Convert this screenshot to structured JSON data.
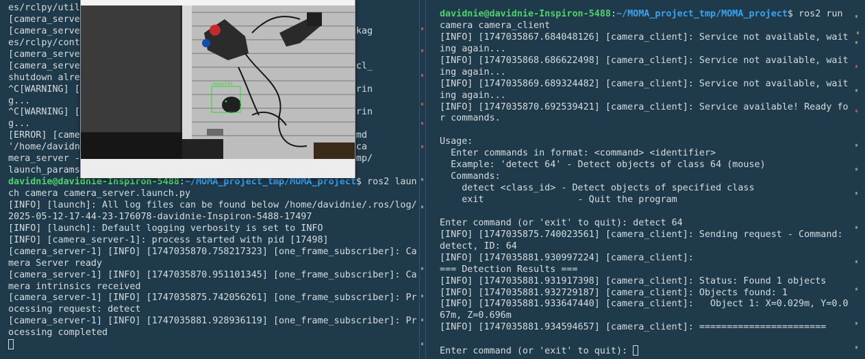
{
  "left_terminal": {
    "lines": [
      "es/rclpy/util",
      "[camera_serve",
      "[camera_serve                                          dist-packag",
      "es/rclpy/cont",
      "[camera_serve",
      "[camera_serve                                          tdown: rcl_",
      "shutdown alre                                          .c:241",
      "^C[WARNING] [                                          in, ignorin",
      "g...",
      "^C[WARNING] [                                          in, ignorin",
      "g...",
      "[ERROR] [came                                          de -2, cmd",
      "'/home/davidn                                          /camera/ca",
      "mera_server -                                          -file /tmp/",
      "launch_params_uxssfliq ]."
    ],
    "prompt": {
      "user_host": "davidnie@davidnie-Inspiron-5488",
      "sep": ":",
      "path": "~/MOMA_project_tmp/MOMA_project",
      "symbol": "$ ros2 laun"
    },
    "lines_after": [
      "ch camera camera_server.launch.py",
      "[INFO] [launch]: All log files can be found below /home/davidnie/.ros/log/",
      "2025-05-12-17-44-23-176078-davidnie-Inspiron-5488-17497",
      "[INFO] [launch]: Default logging verbosity is set to INFO",
      "[INFO] [camera_server-1]: process started with pid [17498]",
      "[camera_server-1] [INFO] [1747035870.758217323] [one_frame_subscriber]: Ca",
      "mera Server ready",
      "[camera_server-1] [INFO] [1747035870.951101345] [one_frame_subscriber]: Ca",
      "mera intrinsics received",
      "[camera_server-1] [INFO] [1747035875.742056261] [one_frame_subscriber]: Pr",
      "ocessing request: detect",
      "[camera_server-1] [INFO] [1747035881.928936119] [one_frame_subscriber]: Pr",
      "ocessing completed"
    ]
  },
  "right_terminal": {
    "prompt": {
      "user_host": "davidnie@davidnie-Inspiron-5488",
      "sep": ":",
      "path": "~/MOMA_project_tmp/MOMA_project",
      "symbol": "$ ros2 run"
    },
    "lines": [
      "camera camera_client",
      "[INFO] [1747035867.684048126] [camera_client]: Service not available, wait",
      "ing again...",
      "[INFO] [1747035868.686622498] [camera_client]: Service not available, wait",
      "ing again...",
      "[INFO] [1747035869.689324482] [camera_client]: Service not available, wait",
      "ing again...",
      "[INFO] [1747035870.692539421] [camera_client]: Service available! Ready fo",
      "r commands.",
      "",
      "Usage:",
      "  Enter commands in format: <command> <identifier>",
      "  Example: 'detect 64' - Detect objects of class 64 (mouse)",
      "  Commands:",
      "    detect <class_id> - Detect objects of specified class",
      "    exit                 - Quit the program",
      "",
      "Enter command (or 'exit' to quit): detect 64",
      "[INFO] [1747035875.740023561] [camera_client]: Sending request - Command:",
      "detect, ID: 64",
      "[INFO] [1747035881.930997224] [camera_client]:",
      "=== Detection Results ===",
      "[INFO] [1747035881.931917398] [camera_client]: Status: Found 1 objects",
      "[INFO] [1747035881.932729187] [camera_client]: Objects found: 1",
      "[INFO] [1747035881.933647440] [camera_client]:   Object 1: X=0.029m, Y=0.0",
      "67m, Z=0.696m",
      "[INFO] [1747035881.934594657] [camera_client]: =======================",
      ""
    ],
    "final_prompt": "Enter command (or 'exit' to quit): "
  },
  "camera_window": {
    "detection_label": "mouse 0.85"
  },
  "colors": {
    "terminal_bg": "#1f3a4a",
    "prompt_user": "#4fd26a",
    "prompt_path": "#3aa3f0",
    "text": "#d6dde0",
    "detection_box": "#22dd22"
  }
}
